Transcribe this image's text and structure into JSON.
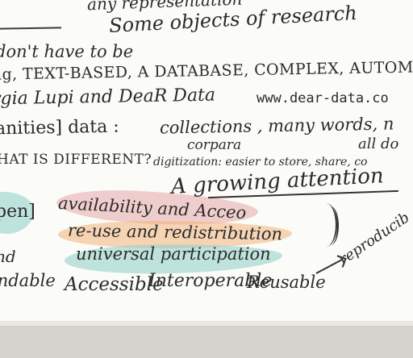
{
  "notes": {
    "line_any_rep": "any representation",
    "line_some_objects": "Some objects of research",
    "line_dont_have": "don't have to be",
    "line_text_based": "ig, TEXT-BASED, A DATABASE, COMPLEX, AUTOMATICALLY G",
    "line_giorgia": "rgia Lupi and DeaR Data",
    "line_url": "www.dear-data.co",
    "line_humanities": "anities] data :",
    "line_collections": "collections , many words, n",
    "line_corpora": "corpara",
    "line_all_do": "all do",
    "line_what_different": "HAT IS DIFFERENT?",
    "line_digitization": "digitization: easier to store, share, co",
    "line_growing": "A growing attention",
    "line_open": "pen]",
    "line_availability": "availability and Acceo",
    "line_reuse": "re-use and redistribution",
    "line_universal": "universal participation",
    "line_nd": "nd",
    "line_reproduc": "reproducib",
    "line_findable": "indable",
    "line_accessible": "Accessible",
    "line_interoperable": "Interoperable",
    "line_reusable": "Reusable"
  },
  "colors": {
    "paper": "#fbfbf7",
    "ink": "#2b2b2b",
    "watercolor_pink": "#e8a8ab",
    "watercolor_orange": "#f2b47c",
    "watercolor_teal": "#8ccdc7"
  }
}
